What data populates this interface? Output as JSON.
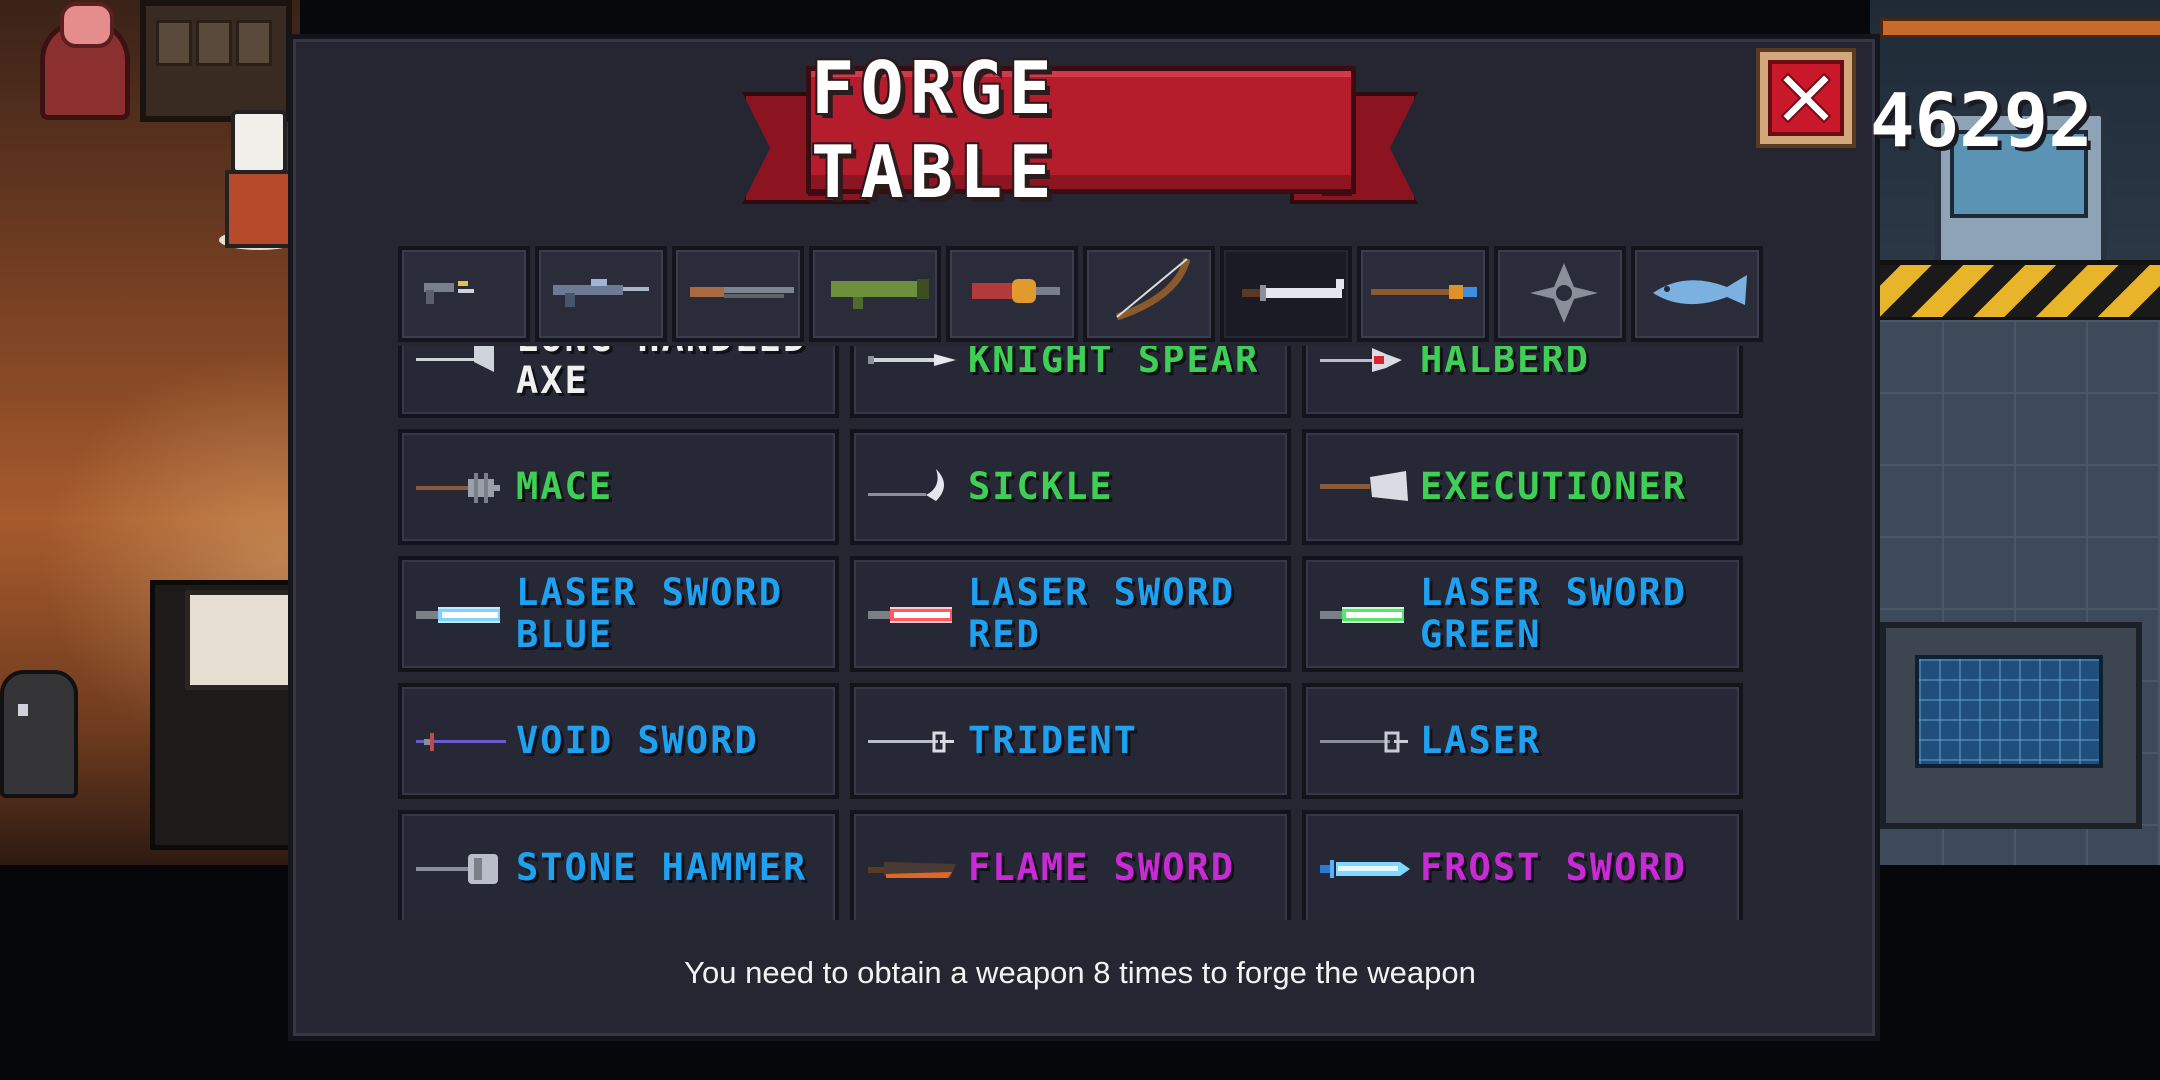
{
  "title": "FORGE TABLE",
  "coins": "46292",
  "close_icon": "close-x-icon",
  "tabs": [
    {
      "icon": "pistol-icon",
      "active": false
    },
    {
      "icon": "rifle-icon",
      "active": false
    },
    {
      "icon": "shotgun-icon",
      "active": false
    },
    {
      "icon": "rocket-launcher-icon",
      "active": false
    },
    {
      "icon": "flamethrower-icon",
      "active": false
    },
    {
      "icon": "bow-icon",
      "active": false
    },
    {
      "icon": "melee-sword-icon",
      "active": true
    },
    {
      "icon": "staff-icon",
      "active": false
    },
    {
      "icon": "throwing-star-icon",
      "active": false
    },
    {
      "icon": "fish-icon",
      "active": false
    }
  ],
  "weapons": [
    {
      "name": "LONG HANDLED AXE",
      "lines": [
        "LONG HANDLED",
        "AXE"
      ],
      "color": "#f0f0f0",
      "icon": "long-axe-icon"
    },
    {
      "name": "KNIGHT SPEAR",
      "lines": [
        "KNIGHT SPEAR"
      ],
      "color": "#3ecf55",
      "icon": "spear-icon"
    },
    {
      "name": "HALBERD",
      "lines": [
        "HALBERD"
      ],
      "color": "#3ecf55",
      "icon": "halberd-icon"
    },
    {
      "name": "MACE",
      "lines": [
        "MACE"
      ],
      "color": "#3ecf55",
      "icon": "mace-icon"
    },
    {
      "name": "SICKLE",
      "lines": [
        "SICKLE"
      ],
      "color": "#3ecf55",
      "icon": "sickle-icon"
    },
    {
      "name": "EXECUTIONER",
      "lines": [
        "EXECUTIONER"
      ],
      "color": "#3ecf55",
      "icon": "executioner-axe-icon"
    },
    {
      "name": "LASER SWORD BLUE",
      "lines": [
        "LASER SWORD",
        "BLUE"
      ],
      "color": "#1fa1f2",
      "icon": "laser-sword-blue-icon"
    },
    {
      "name": "LASER SWORD RED",
      "lines": [
        "LASER SWORD",
        "RED"
      ],
      "color": "#1fa1f2",
      "icon": "laser-sword-red-icon"
    },
    {
      "name": "LASER SWORD GREEN",
      "lines": [
        "LASER SWORD",
        "GREEN"
      ],
      "color": "#1fa1f2",
      "icon": "laser-sword-green-icon"
    },
    {
      "name": "VOID SWORD",
      "lines": [
        "VOID SWORD"
      ],
      "color": "#1fa1f2",
      "icon": "void-sword-icon"
    },
    {
      "name": "TRIDENT",
      "lines": [
        "TRIDENT"
      ],
      "color": "#1fa1f2",
      "icon": "trident-icon"
    },
    {
      "name": "LASER",
      "lines": [
        "LASER"
      ],
      "color": "#1fa1f2",
      "icon": "laser-trident-icon"
    },
    {
      "name": "STONE HAMMER",
      "lines": [
        "STONE HAMMER"
      ],
      "color": "#1fa1f2",
      "icon": "stone-hammer-icon"
    },
    {
      "name": "FLAME SWORD",
      "lines": [
        "FLAME SWORD"
      ],
      "color": "#c82ad6",
      "icon": "flame-sword-icon"
    },
    {
      "name": "FROST SWORD",
      "lines": [
        "FROST SWORD"
      ],
      "color": "#c82ad6",
      "icon": "frost-sword-icon"
    }
  ],
  "hint": "You need to obtain a weapon 8 times to forge the weapon"
}
